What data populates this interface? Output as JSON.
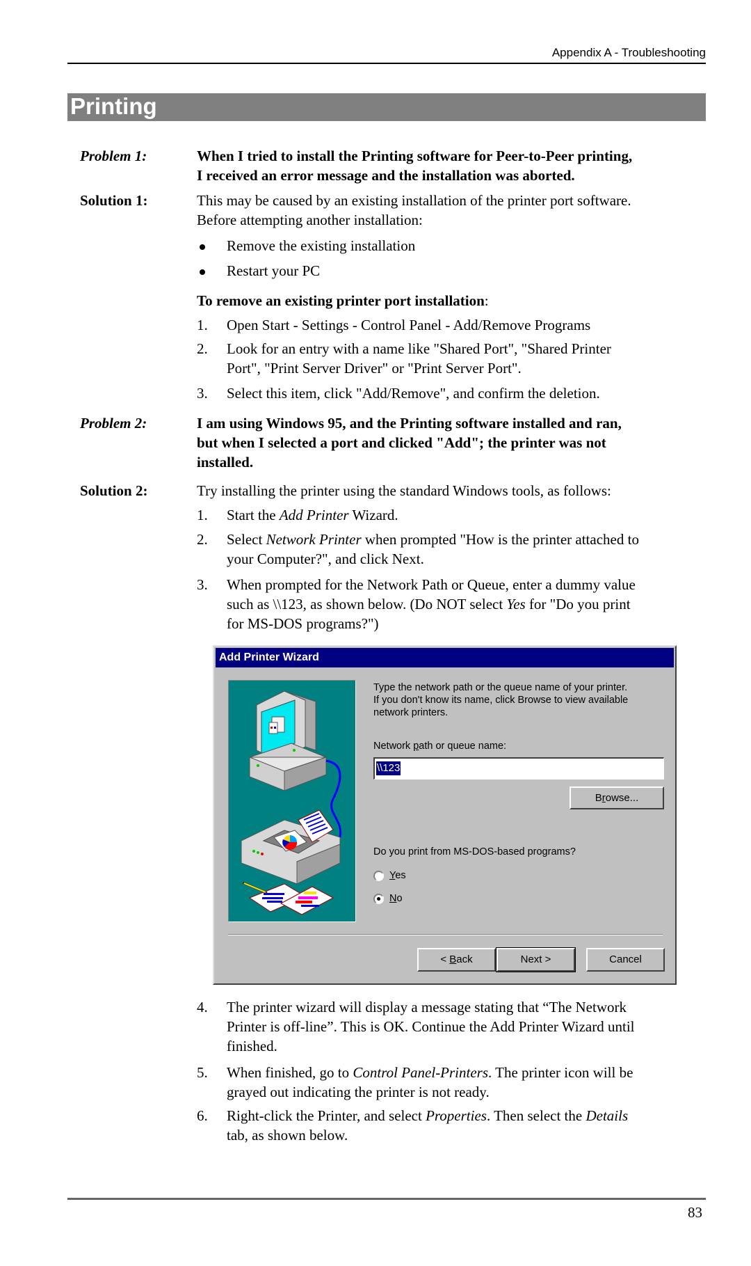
{
  "header": {
    "running_title": "Appendix A - Troubleshooting"
  },
  "section": {
    "title": "Printing"
  },
  "problem1": {
    "label": "Problem 1:",
    "lines": [
      "When I tried to install the Printing software for Peer-to-Peer printing,",
      "I received an error message and the installation was aborted."
    ]
  },
  "solution1": {
    "label": "Solution 1:",
    "intro_lines": [
      "This may be caused by an existing installation of the printer port software.",
      "Before attempting another installation:"
    ],
    "bullets": [
      "Remove the existing installation",
      "Restart your PC"
    ],
    "subheading": "To remove an existing printer port installation",
    "subheading_suffix": ":",
    "steps": [
      {
        "num": "1.",
        "lines": [
          "Open Start - Settings - Control Panel - Add/Remove Programs"
        ]
      },
      {
        "num": "2.",
        "lines": [
          "Look for an entry with a name like \"Shared Port\", \"Shared Printer",
          "Port\", \"Print Server Driver\" or \"Print Server Port\"."
        ]
      },
      {
        "num": "3.",
        "lines": [
          "Select this item, click \"Add/Remove\", and confirm the deletion."
        ]
      }
    ]
  },
  "problem2": {
    "label": "Problem 2:",
    "lines": [
      "I am using Windows 95, and the Printing software installed and ran,",
      "but when I selected a port and clicked \"Add\"; the printer was not",
      "installed."
    ]
  },
  "solution2": {
    "label": "Solution 2:",
    "intro": "Try installing the printer using the standard Windows tools, as follows:",
    "step1": {
      "num": "1.",
      "pre": "Start the ",
      "em": "Add Printer",
      "post": " Wizard."
    },
    "step2": {
      "num": "2.",
      "pre": "Select ",
      "em": "Network Printer",
      "post": " when prompted \"How is the printer attached to",
      "line2": "your Computer?\", and click Next."
    },
    "step3": {
      "num": "3.",
      "line1": "When prompted for the Network Path or Queue, enter a dummy value",
      "line2_pre": "such as \\\\123, as shown below. (Do NOT select ",
      "line2_em": "Yes",
      "line2_post": " for \"Do you print",
      "line3": "for MS-DOS programs?\")"
    },
    "step4": {
      "num": "4.",
      "lines": [
        "The printer wizard will display a message stating that “The Network",
        "Printer is off-line”. This is OK. Continue the Add Printer Wizard until",
        "finished."
      ]
    },
    "step5": {
      "num": "5.",
      "pre": "When finished, go to ",
      "em": "Control Panel-Printers",
      "post": ". The printer icon will be",
      "line2": "grayed out indicating the printer is not ready."
    },
    "step6": {
      "num": "6.",
      "pre": "Right-click the Printer, and select ",
      "em": "Properties",
      "mid": ". Then select the ",
      "em2": "Details",
      "line2": "tab, as shown below."
    }
  },
  "dialog": {
    "title": "Add Printer Wizard",
    "instructions": [
      "Type the network path or the queue name of your printer.",
      "If you don't know its name, click Browse to view available",
      "network printers."
    ],
    "path_label_pre": "Network ",
    "path_label_key": "p",
    "path_label_post": "ath or queue name:",
    "path_value": "\\\\123",
    "browse_pre": "B",
    "browse_key": "r",
    "browse_post": "owse...",
    "dos_question": "Do you print from MS-DOS-based programs?",
    "radio_yes_key": "Y",
    "radio_yes_rest": "es",
    "radio_no_key": "N",
    "radio_no_rest": "o",
    "selected_option": "No",
    "back_pre": "< ",
    "back_key": "B",
    "back_rest": "ack",
    "next_label": "Next >",
    "cancel_label": "Cancel",
    "colors": {
      "titlebar": "#000080",
      "face": "#c0c0c0",
      "art_bg": "#008080"
    }
  },
  "footer": {
    "page_number": "83"
  }
}
